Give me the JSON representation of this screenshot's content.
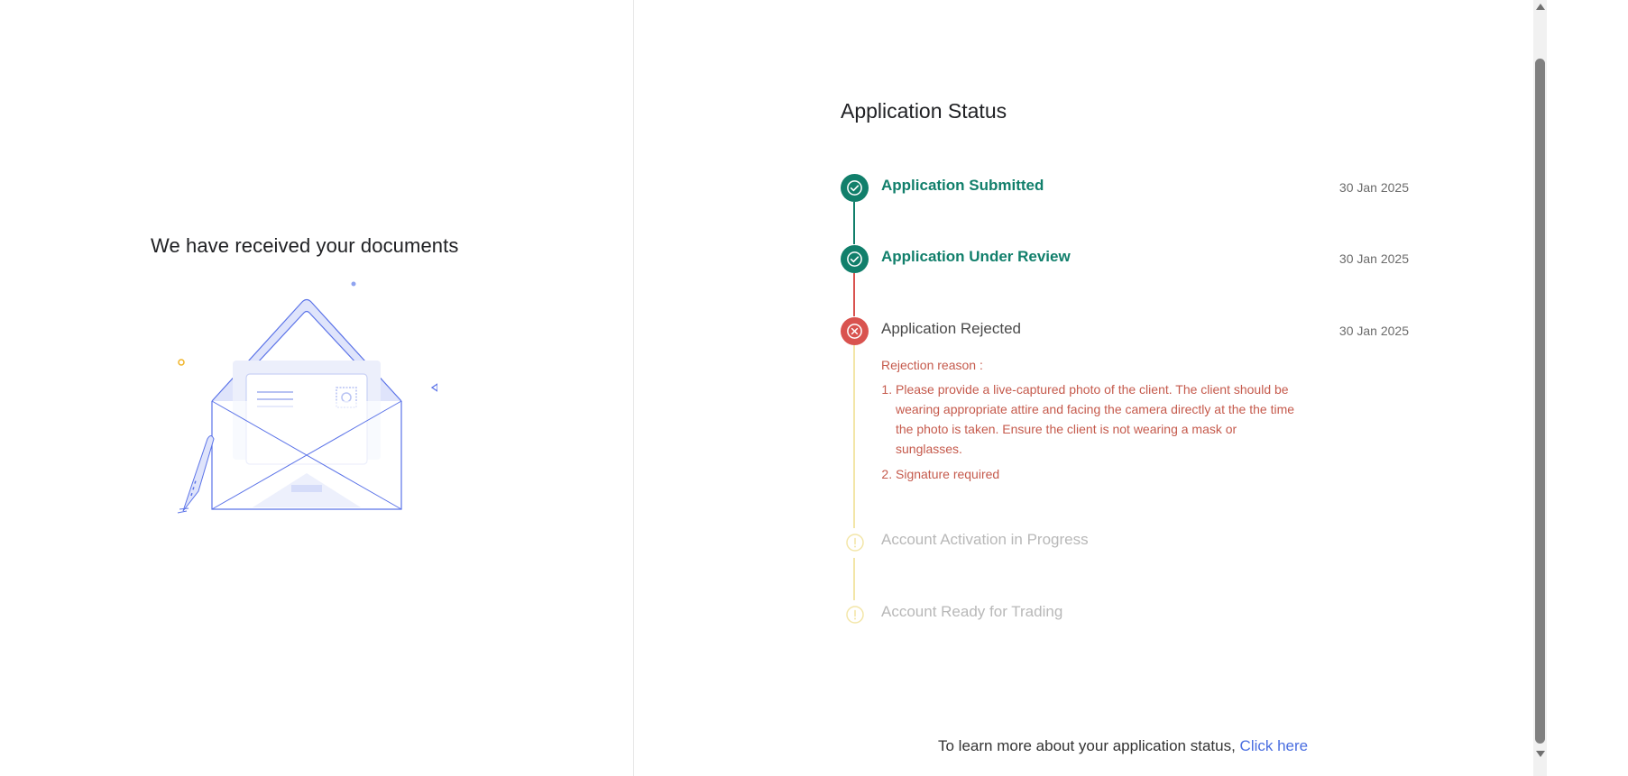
{
  "left": {
    "title": "We have received your documents"
  },
  "status": {
    "title": "Application Status",
    "steps": [
      {
        "label": "Application Submitted",
        "date": "30 Jan 2025",
        "state": "done"
      },
      {
        "label": "Application Under Review",
        "date": "30 Jan 2025",
        "state": "done"
      },
      {
        "label": "Application Rejected",
        "date": "30 Jan 2025",
        "state": "rejected"
      },
      {
        "label": "Account Activation in Progress",
        "date": "",
        "state": "pending"
      },
      {
        "label": "Account Ready for Trading",
        "date": "",
        "state": "pending"
      }
    ],
    "rejection": {
      "title": "Rejection reason :",
      "items": [
        "Please provide a live-captured photo of the client. The client should be wearing appropriate attire and facing the camera directly at the the time the photo is taken. Ensure the client is not wearing a mask or sunglasses.",
        "Signature required"
      ]
    }
  },
  "footer": {
    "text": "To learn more about your application status,",
    "link": "Click here"
  },
  "colors": {
    "success": "#117f6b",
    "error": "#d9534f",
    "pending": "#f3e6a8",
    "link": "#4a6ee0"
  },
  "icons": {
    "done": "check-circle-icon",
    "rejected": "x-circle-icon",
    "pending": "info-circle-icon"
  }
}
